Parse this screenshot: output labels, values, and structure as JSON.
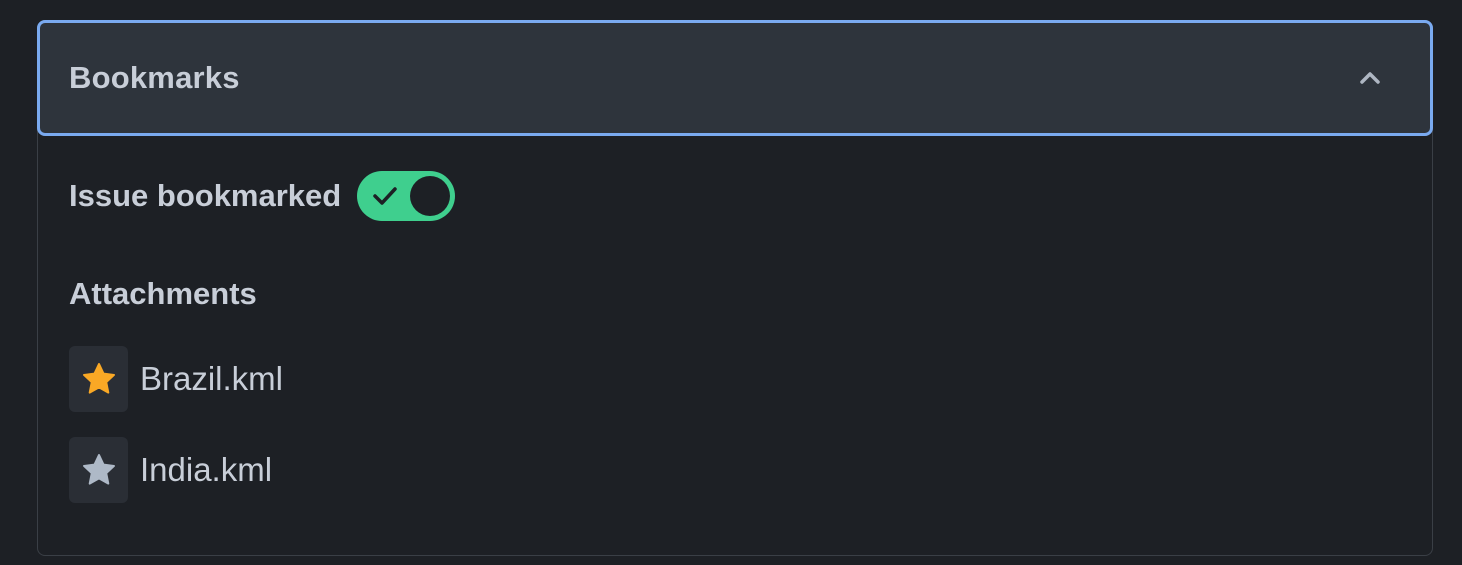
{
  "panel": {
    "title": "Bookmarks",
    "expanded": true,
    "chevron_icon": "chevron-up-icon"
  },
  "bookmark_toggle": {
    "label": "Issue bookmarked",
    "checked": true,
    "icon": "check-icon",
    "on_color": "#3fcf8e"
  },
  "attachments": {
    "title": "Attachments",
    "items": [
      {
        "name": "Brazil.kml",
        "starred": true,
        "star_color": "#f9a825",
        "icon": "star-filled-icon"
      },
      {
        "name": "India.kml",
        "starred": false,
        "star_color": "#aeb9c7",
        "icon": "star-icon"
      }
    ]
  },
  "colors": {
    "background": "#1d2025",
    "header_background": "#2e343c",
    "focus_ring": "#7aaaf0",
    "text": "#c8ced8"
  }
}
